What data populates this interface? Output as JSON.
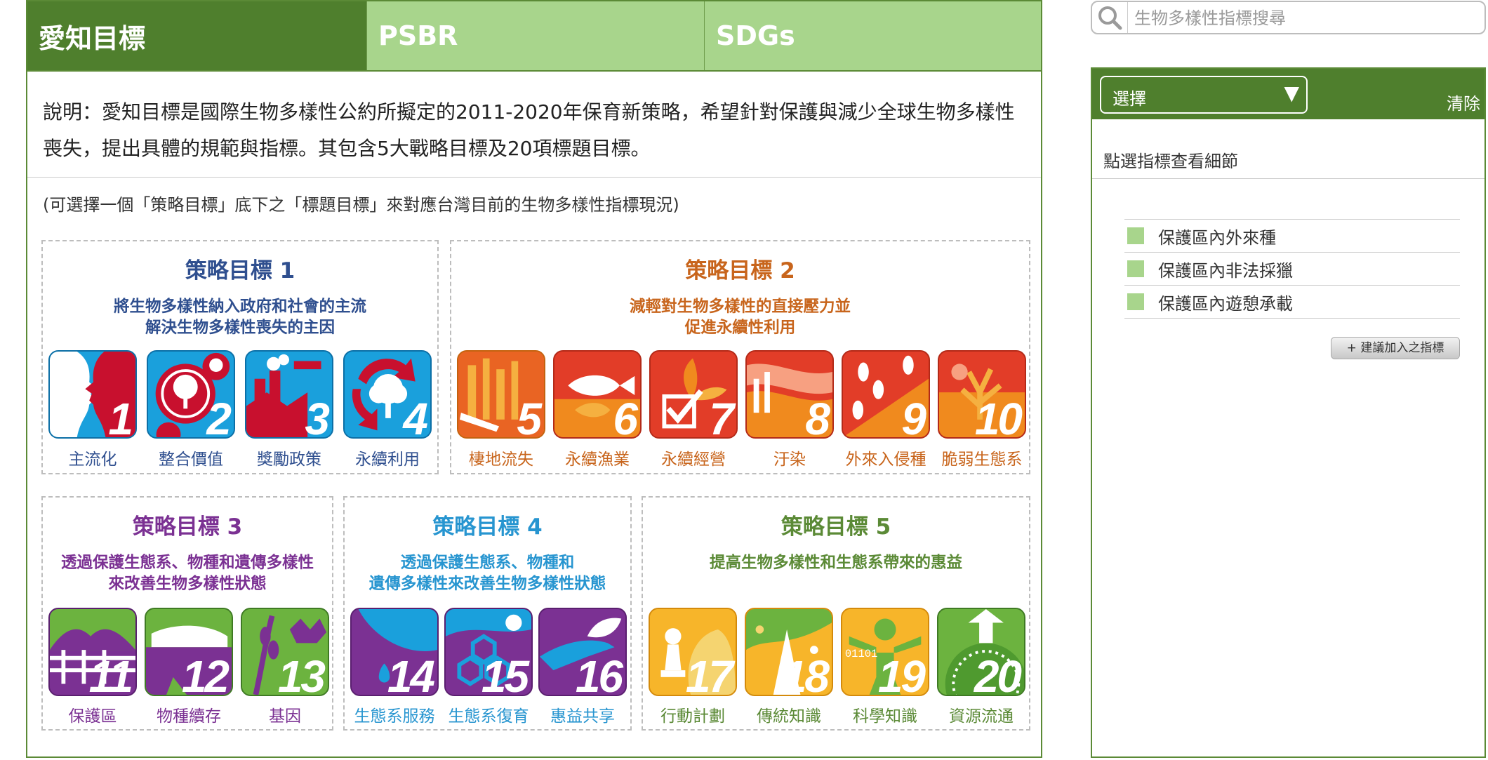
{
  "tabs": [
    {
      "label": "愛知目標",
      "active": true
    },
    {
      "label": "PSBR",
      "active": false
    },
    {
      "label": "SDGs",
      "active": false
    }
  ],
  "description": "說明：愛知目標是國際生物多樣性公約所擬定的2011-2020年保育新策略，希望針對保護與減少全球生物多樣性喪失，提出具體的規範與指標。其包含5大戰略目標及20項標題目標。",
  "hint": "(可選擇一個「策略目標」底下之「標題目標」來對應台灣目前的生物多樣性指標現況)",
  "goals": [
    {
      "title": "策略目標 1",
      "subtitle": "將生物多樣性納入政府和社會的主流\n解決生物多樣性喪失的主因",
      "color": "#2f4f8f"
    },
    {
      "title": "策略目標 2",
      "subtitle": "減輕對生物多樣性的直接壓力並\n促進永續性利用",
      "color": "#c8651c"
    },
    {
      "title": "策略目標 3",
      "subtitle": "透過保護生態系、物種和遺傳多樣性\n來改善生物多樣性狀態",
      "color": "#7b3193"
    },
    {
      "title": "策略目標 4",
      "subtitle": "透過保護生態系、物種和\n遺傳多樣性來改善生物多樣性狀態",
      "color": "#2795d0"
    },
    {
      "title": "策略目標 5",
      "subtitle": "提高生物多樣性和生態系帶來的惠益",
      "color": "#5b8a36"
    }
  ],
  "targets": [
    {
      "number": "1",
      "label": "主流化",
      "icon": "human-face-icon"
    },
    {
      "number": "2",
      "label": "整合價值",
      "icon": "tree-coins-icon"
    },
    {
      "number": "3",
      "label": "獎勵政策",
      "icon": "factory-icon"
    },
    {
      "number": "4",
      "label": "永續利用",
      "icon": "tree-recycle-icon"
    },
    {
      "number": "5",
      "label": "棲地流失",
      "icon": "forest-saw-icon"
    },
    {
      "number": "6",
      "label": "永續漁業",
      "icon": "fish-icon"
    },
    {
      "number": "7",
      "label": "永續經營",
      "icon": "plant-checkbox-icon"
    },
    {
      "number": "8",
      "label": "汙染",
      "icon": "pollution-icon"
    },
    {
      "number": "9",
      "label": "外來入侵種",
      "icon": "footprints-icon"
    },
    {
      "number": "10",
      "label": "脆弱生態系",
      "icon": "coral-icon"
    },
    {
      "number": "11",
      "label": "保護區",
      "icon": "fence-grass-icon"
    },
    {
      "number": "12",
      "label": "物種續存",
      "icon": "bear-icon"
    },
    {
      "number": "13",
      "label": "基因",
      "icon": "wheat-cow-icon"
    },
    {
      "number": "14",
      "label": "生態系服務",
      "icon": "leaf-water-icon"
    },
    {
      "number": "15",
      "label": "生態系復育",
      "icon": "hexagon-network-icon"
    },
    {
      "number": "16",
      "label": "惠益共享",
      "icon": "hand-leaf-icon"
    },
    {
      "number": "17",
      "label": "行動計劃",
      "icon": "chess-squirrel-icon"
    },
    {
      "number": "18",
      "label": "傳統知識",
      "icon": "tent-pattern-icon"
    },
    {
      "number": "19",
      "label": "科學知識",
      "icon": "human-binary-icon"
    },
    {
      "number": "20",
      "label": "資源流通",
      "icon": "coin-arrow-icon"
    }
  ],
  "sidebar": {
    "search_placeholder": "生物多樣性指標搜尋",
    "select_label": "選擇",
    "clear_label": "清除",
    "info": "點選指標查看細節",
    "indicators": [
      "保護區內外來種",
      "保護區內非法採獵",
      "保護區內遊憩承載"
    ],
    "suggest_label": "+ 建議加入之指標"
  },
  "colors": {
    "primary_green": "#4f7f2d",
    "light_green": "#a8d58c",
    "goal1": "#2f4f8f",
    "goal2": "#c8651c",
    "goal3": "#7b3193",
    "goal4": "#2795d0",
    "goal5": "#5b8a36"
  }
}
